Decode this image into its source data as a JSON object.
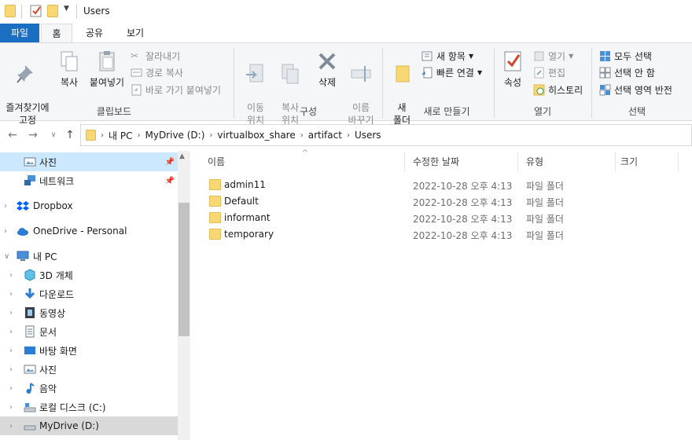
{
  "window": {
    "title": "Users"
  },
  "tabs": {
    "file": "파일",
    "home": "홈",
    "share": "공유",
    "view": "보기"
  },
  "ribbon": {
    "clipboard": {
      "label": "클립보드",
      "pin_quick": "즐겨찾기에\n고정",
      "copy": "복사",
      "paste": "붙여넣기",
      "cut": "잘라내기",
      "copy_path": "경로 복사",
      "paste_shortcut": "바로 가기 붙여넣기"
    },
    "organize": {
      "label": "구성",
      "move_to": "이동\n위치",
      "copy_to": "복사\n위치",
      "delete": "삭제",
      "rename": "이름\n바꾸기"
    },
    "new": {
      "label": "새로 만들기",
      "new_folder": "새\n폴더",
      "new_item": "새 항목",
      "easy_access": "빠른 연결"
    },
    "open": {
      "label": "열기",
      "properties": "속성",
      "open": "열기",
      "edit": "편집",
      "history": "히스토리"
    },
    "select": {
      "label": "선택",
      "select_all": "모두 선택",
      "select_none": "선택 안 함",
      "invert": "선택 영역 반전"
    }
  },
  "address": {
    "crumbs": [
      "내 PC",
      "MyDrive (D:)",
      "virtualbox_share",
      "artifact",
      "Users"
    ]
  },
  "sidebar": {
    "items": [
      {
        "label": "사진",
        "pinned": true
      },
      {
        "label": "네트워크",
        "pinned": true
      },
      {
        "label": "Dropbox"
      },
      {
        "label": "OneDrive - Personal"
      },
      {
        "label": "내 PC"
      },
      {
        "label": "3D 개체"
      },
      {
        "label": "다운로드"
      },
      {
        "label": "동영상"
      },
      {
        "label": "문서"
      },
      {
        "label": "바탕 화면"
      },
      {
        "label": "사진"
      },
      {
        "label": "음악"
      },
      {
        "label": "로컬 디스크 (C:)"
      },
      {
        "label": "MyDrive (D:)"
      }
    ]
  },
  "columns": {
    "name": "이름",
    "modified": "수정한 날짜",
    "type": "유형",
    "size": "크기"
  },
  "files": [
    {
      "name": "admin11",
      "modified": "2022-10-28 오후 4:13",
      "type": "파일 폴더"
    },
    {
      "name": "Default",
      "modified": "2022-10-28 오후 4:13",
      "type": "파일 폴더"
    },
    {
      "name": "informant",
      "modified": "2022-10-28 오후 4:13",
      "type": "파일 폴더"
    },
    {
      "name": "temporary",
      "modified": "2022-10-28 오후 4:13",
      "type": "파일 폴더"
    }
  ],
  "colors": {
    "file_tab": "#1a6fc2",
    "selection": "#cce8ff",
    "folder": "#f8d775"
  }
}
